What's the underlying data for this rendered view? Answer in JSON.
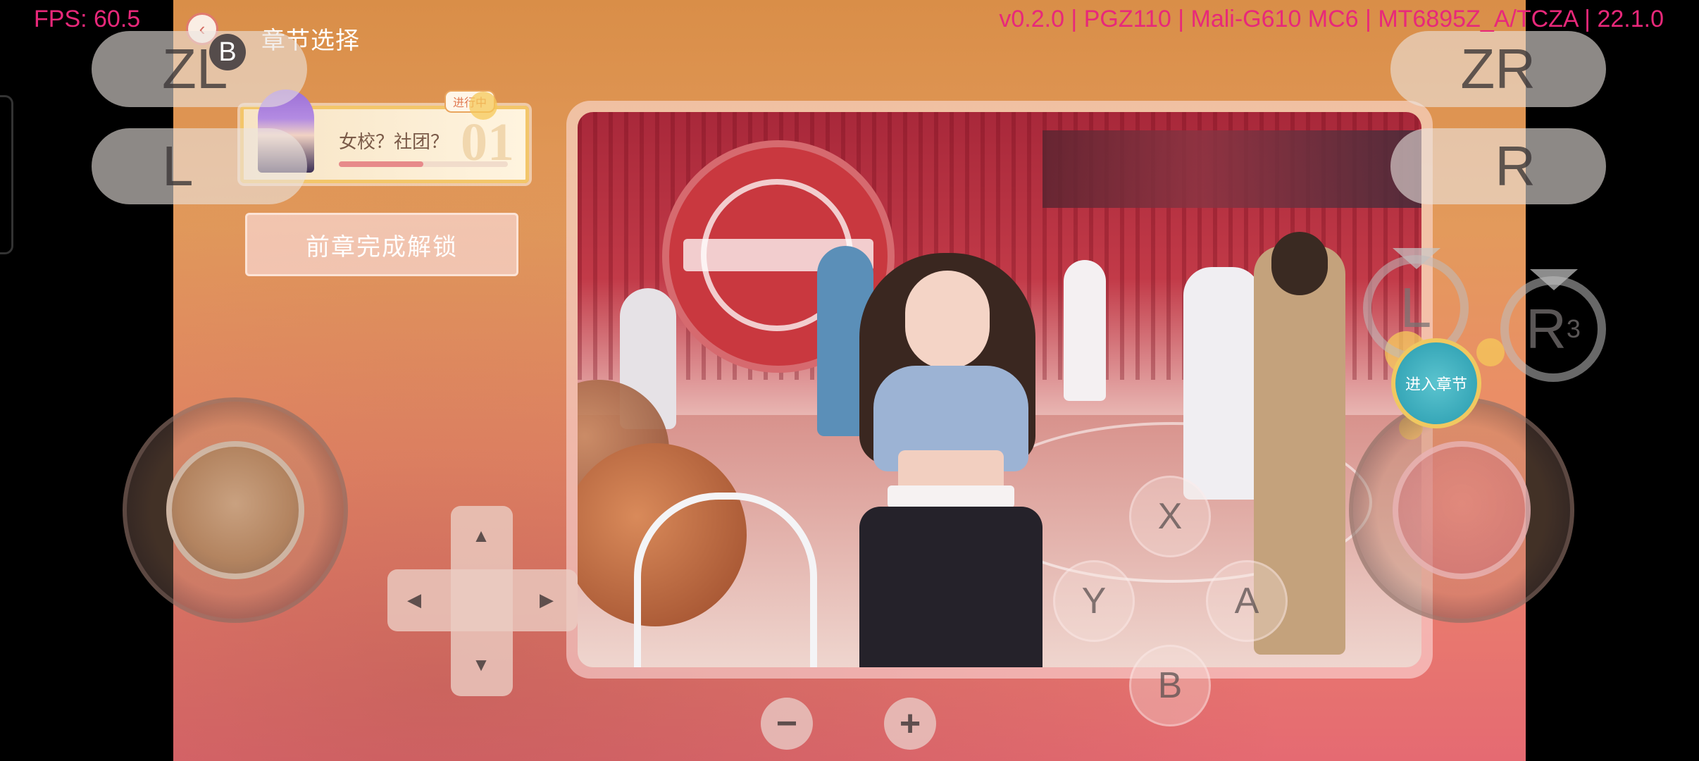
{
  "overlay": {
    "fps": "FPS: 60.5",
    "version": "v0.2.0 | PGZ110 | Mali-G610 MC6 | MT6895Z_A/TCZA | 22.1.0"
  },
  "game": {
    "back_icon": "‹",
    "chapter_select_title": "章节选择",
    "chapter_card": {
      "status": "进行中",
      "name": "女校？社团？",
      "number": "01",
      "progress": 0.5
    },
    "unlock_button": "前章完成解锁",
    "enter_chapter_button": "进入章节"
  },
  "controller": {
    "zl": "ZL",
    "zr": "ZR",
    "l": "L",
    "r": "R",
    "b_small": "B",
    "face_x": "X",
    "face_y": "Y",
    "face_a": "A",
    "face_b": "B",
    "minus": "−",
    "plus": "+",
    "l_stick": "L",
    "r_stick": "R",
    "r_stick_sup": "3",
    "dpad_up": "▲",
    "dpad_down": "▼",
    "dpad_left": "◀",
    "dpad_right": "▶"
  },
  "colors": {
    "overlay_text": "#e8287a",
    "enter_chapter_bg": "#37a7b8",
    "card_border": "#f3c66a"
  }
}
